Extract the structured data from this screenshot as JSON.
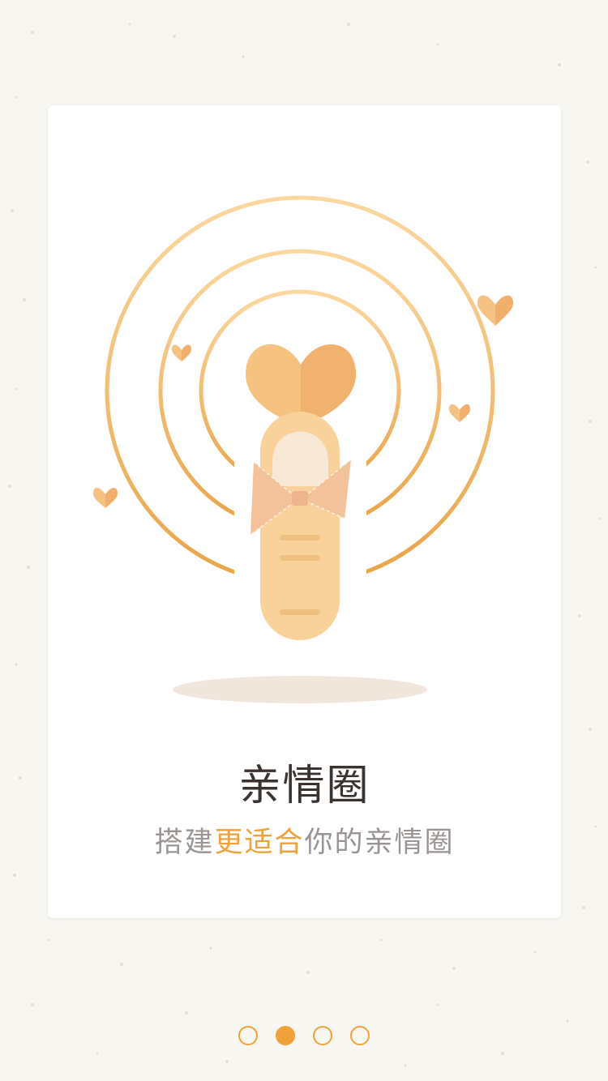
{
  "onboarding": {
    "title": "亲情圈",
    "subtitle": {
      "part1": "搭建",
      "highlight": "更适合",
      "part2": "你的亲情圈"
    },
    "illustration": "finger-with-heart-and-bow-icon"
  },
  "pager": {
    "page_count": 4,
    "active_index": 1
  },
  "colors": {
    "accent": "#f0a23a",
    "title": "#3a3330",
    "subtitle": "#9a9593",
    "background": "#f8f6f1",
    "card": "#ffffff"
  }
}
